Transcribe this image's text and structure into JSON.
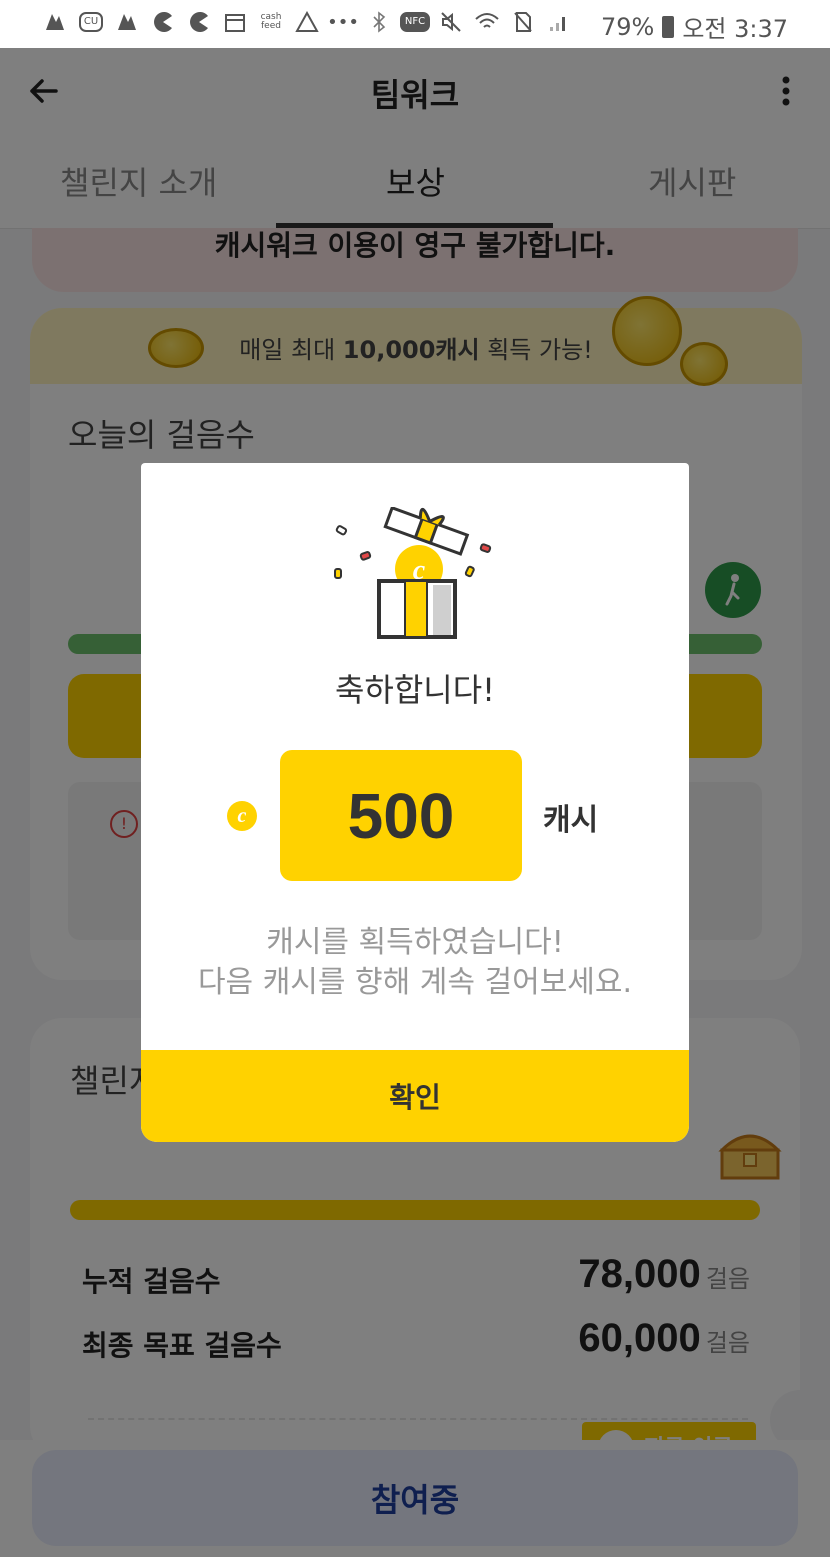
{
  "status_bar": {
    "badges": [
      "CU",
      "cash feed",
      "NFC"
    ],
    "battery": "79%",
    "time": "오전 3:37"
  },
  "app_bar": {
    "title": "팀워크"
  },
  "tabs": [
    {
      "label": "챌린지 소개"
    },
    {
      "label": "보상"
    },
    {
      "label": "게시판"
    }
  ],
  "warning": {
    "text": "캐시워크 이용이 영구 불가합니다."
  },
  "daily": {
    "banner_prefix": "매일 최대 ",
    "banner_amount": "10,000캐시",
    "banner_suffix": " 획득 가능!",
    "steps_title": "오늘의 걸음수"
  },
  "challenge": {
    "title": "챌린지",
    "stats": [
      {
        "label": "누적 걸음수",
        "value": "78,000",
        "unit": "걸음"
      },
      {
        "label": "최종 목표 걸음수",
        "value": "60,000",
        "unit": "걸음"
      }
    ],
    "button_label": "지금 이루"
  },
  "bottom": {
    "join_label": "참여중"
  },
  "modal": {
    "title": "축하합니다!",
    "coin_letter": "c",
    "amount": "500",
    "unit": "캐시",
    "message_line1": "캐시를 획득하였습니다!",
    "message_line2": "다음 캐시를 향해 계속 걸어보세요.",
    "confirm_label": "확인"
  },
  "colors": {
    "accent": "#ffd200",
    "dim_overlay": "rgba(0,0,0,0.5)",
    "progress_green": "#5aa05a"
  }
}
